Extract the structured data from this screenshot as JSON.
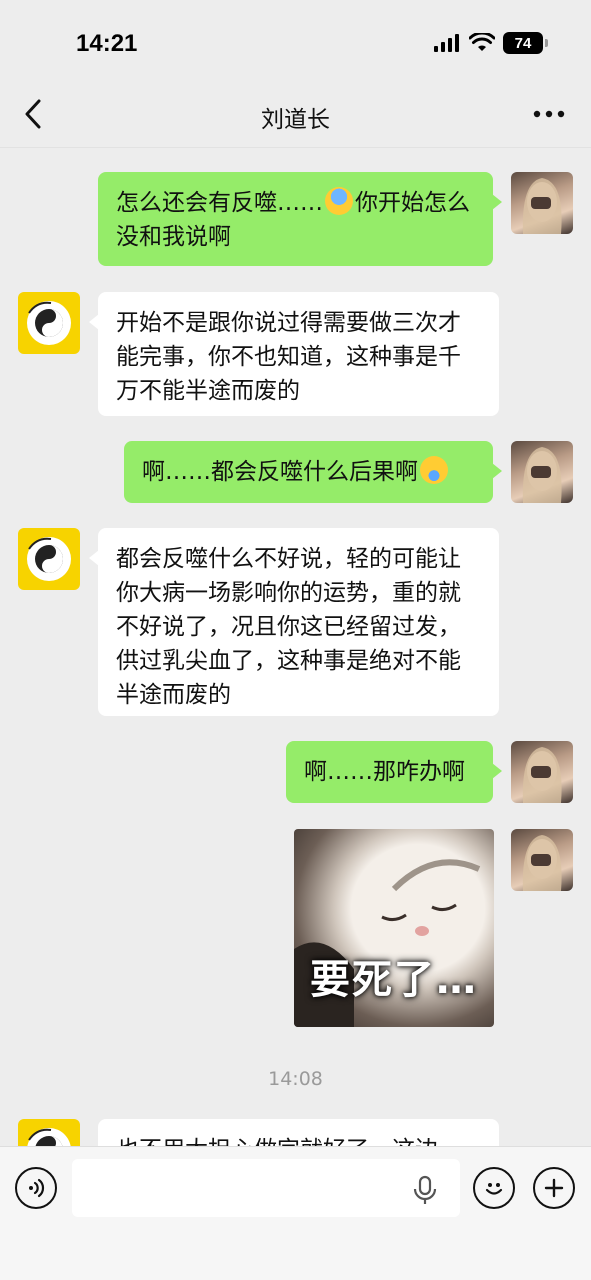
{
  "status": {
    "time": "14:21",
    "battery": "74"
  },
  "nav": {
    "title": "刘道长"
  },
  "messages": [
    {
      "side": "self",
      "text_before": "怎么还会有反噬……",
      "emoji": "fear",
      "text_after": "你开始怎么没和我说啊"
    },
    {
      "side": "other",
      "text": "开始不是跟你说过得需要做三次才能完事，你不也知道，这种事是千万不能半途而废的"
    },
    {
      "side": "self",
      "text_before": "啊……都会反噬什么后果啊",
      "emoji": "cry"
    },
    {
      "side": "other",
      "text": "都会反噬什么不好说，轻的可能让你大病一场影响你的运势，重的就不好说了，况且你这已经留过发，供过乳尖血了，这种事是绝对不能半途而废的"
    },
    {
      "side": "self",
      "text": "啊……那咋办啊"
    },
    {
      "side": "self",
      "type": "sticker",
      "sticker_text": "要死了…"
    },
    {
      "side": "other",
      "text": "也不用太担心做完就好了，这边"
    }
  ],
  "time_divider": "14:08",
  "input": {
    "value": ""
  }
}
